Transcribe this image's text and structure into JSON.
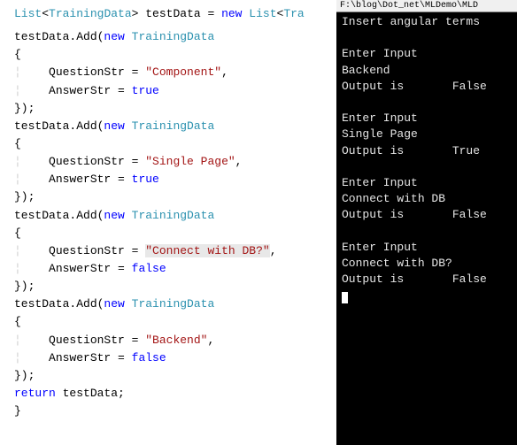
{
  "editor": {
    "l1_a": "List",
    "l1_b": "<",
    "l1_c": "TrainingData",
    "l1_d": "> testData = ",
    "l1_e": "new",
    "l1_f": " ",
    "l1_g": "List",
    "l1_h": "<",
    "l1_i": "Tra",
    "l2_a": "testData.Add(",
    "l2_b": "new",
    "l2_c": " ",
    "l2_d": "TrainingData",
    "l3": "{",
    "guide": "¦",
    "qstr_a": "    QuestionStr = ",
    "astr_a": "    AnswerStr = ",
    "true": "true",
    "false": "false",
    "closebr": "});",
    "close_inner": "}",
    "q1": "\"Component\"",
    "q2": "\"Single Page\"",
    "q3": "\"Connect with DB?\"",
    "q4": "\"Backend\"",
    "comma": ",",
    "return_a": "return",
    "return_b": " testData;"
  },
  "console": {
    "title_partial": "F:\\blog\\Dot_net\\MLDemo\\MLD",
    "l0": "Insert angular terms",
    "l1": " ",
    "l2": "Enter Input",
    "l3": "Backend",
    "l4": "Output is       False",
    "l5": " ",
    "l6": "Enter Input",
    "l7": "Single Page",
    "l8": "Output is       True",
    "l9": " ",
    "l10": "Enter Input",
    "l11": "Connect with DB",
    "l12": "Output is       False",
    "l13": " ",
    "l14": "Enter Input",
    "l15": "Connect with DB?",
    "l16": "Output is       False"
  }
}
